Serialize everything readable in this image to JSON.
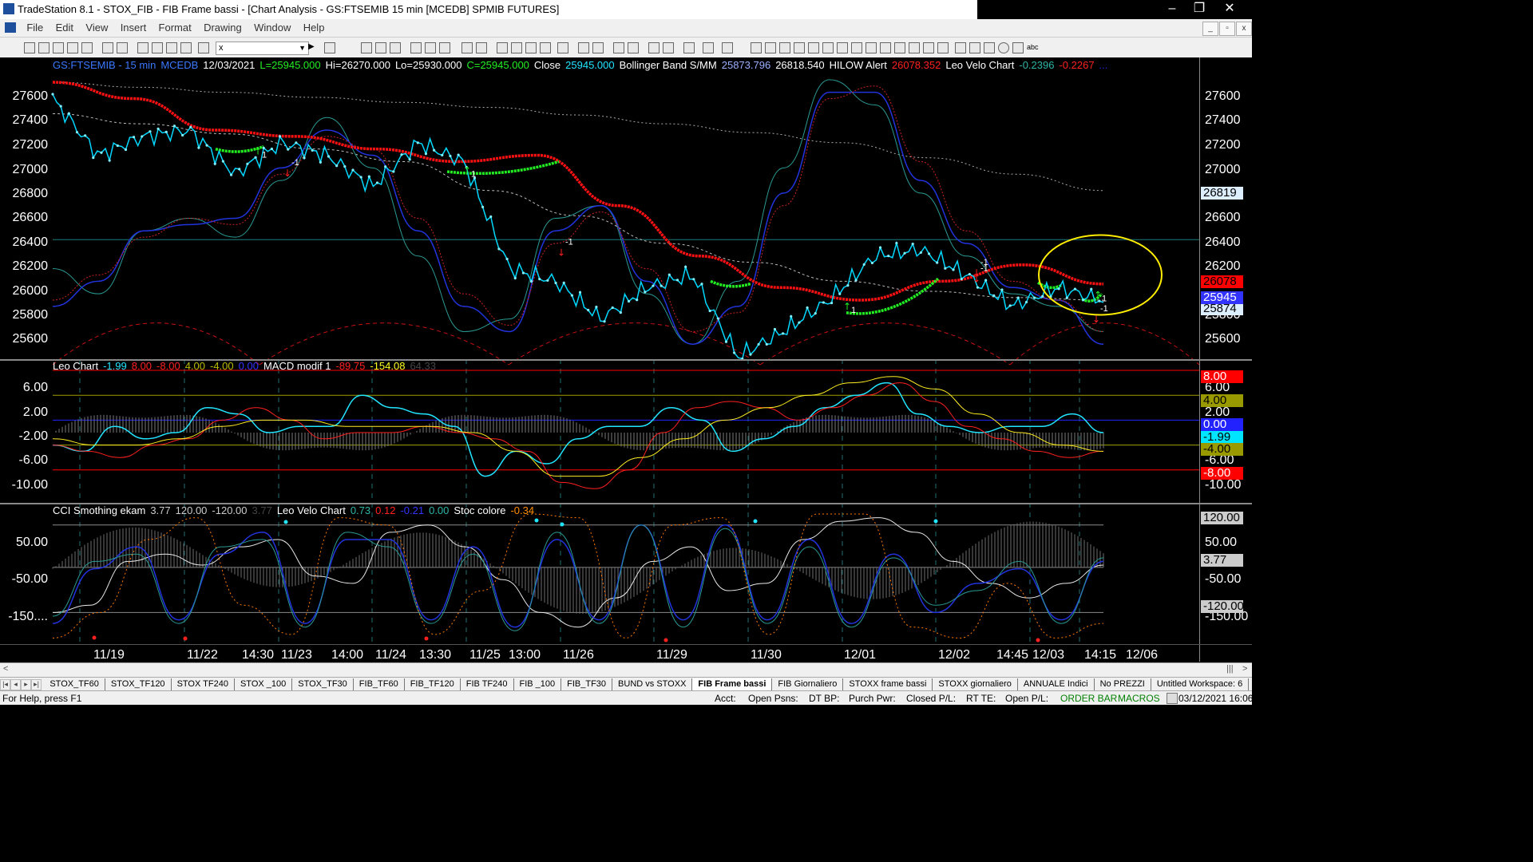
{
  "window": {
    "title": "TradeStation 8.1 - STOX_FIB - FIB Frame bassi - [Chart Analysis - GS:FTSEMIB  15 min  [MCEDB] SPMIB FUTURES]",
    "buttons": {
      "minimize": "–",
      "restore": "❐",
      "close": "✕"
    }
  },
  "menu": [
    "File",
    "Edit",
    "View",
    "Insert",
    "Format",
    "Drawing",
    "Window",
    "Help"
  ],
  "mdi_buttons": [
    "_",
    "▫",
    "x"
  ],
  "toolbar": {
    "symbol_value": "x",
    "dropdown": "▼"
  },
  "price_header": [
    {
      "text": "GS:FTSEMIB - 15 min",
      "color": "#3a78ff"
    },
    {
      "text": "MCEDB",
      "color": "#3a78ff"
    },
    {
      "text": "12/03/2021",
      "color": "#ffffff"
    },
    {
      "text": "L=25945.000",
      "color": "#22ee22"
    },
    {
      "text": "Hi=26270.000",
      "color": "#ffffff"
    },
    {
      "text": "Lo=25930.000",
      "color": "#ffffff"
    },
    {
      "text": "C=25945.000",
      "color": "#22ee22"
    },
    {
      "text": "Close",
      "color": "#ffffff"
    },
    {
      "text": "25945.000",
      "color": "#22e5ff"
    },
    {
      "text": "Bollinger Band S/MM",
      "color": "#ffffff"
    },
    {
      "text": "25873.796",
      "color": "#9ab0ff"
    },
    {
      "text": "26818.540",
      "color": "#ffffff"
    },
    {
      "text": "HILOW Alert",
      "color": "#ffffff"
    },
    {
      "text": "26078.352",
      "color": "#ff2020"
    },
    {
      "text": "Leo Velo Chart",
      "color": "#ffffff"
    },
    {
      "text": "-0.2396",
      "color": "#2fb5a8"
    },
    {
      "text": "-0.2267",
      "color": "#ff2020"
    },
    {
      "text": "...",
      "color": "#2222dd"
    }
  ],
  "price_axis_left": [
    "27600",
    "27400",
    "27200",
    "27000",
    "26800",
    "26600",
    "26400",
    "26200",
    "26000",
    "25800",
    "25600"
  ],
  "price_axis_right": [
    "27600",
    "27400",
    "27200",
    "27000",
    "26600",
    "26400",
    "26200",
    "25800",
    "25600"
  ],
  "price_tags": [
    {
      "text": "26819",
      "bg": "#ddeeff",
      "fg": "#000000"
    },
    {
      "text": "26078",
      "bg": "#ff0000",
      "fg": "#000000"
    },
    {
      "text": "25945",
      "bg": "#3333ff",
      "fg": "#ffffff"
    },
    {
      "text": "25874",
      "bg": "#ddeeff",
      "fg": "#000000"
    }
  ],
  "macd_header": [
    {
      "text": "Leo Chart",
      "color": "#ffffff"
    },
    {
      "text": "-1.99",
      "color": "#22e5ff"
    },
    {
      "text": "8.00",
      "color": "#ff2020"
    },
    {
      "text": "-8.00",
      "color": "#ff2020"
    },
    {
      "text": "4.00",
      "color": "#bbbb00"
    },
    {
      "text": "-4.00",
      "color": "#bbbb00"
    },
    {
      "text": "0.00",
      "color": "#3333ff"
    },
    {
      "text": "MACD modif 1",
      "color": "#ffffff"
    },
    {
      "text": "-89.75",
      "color": "#ff2020"
    },
    {
      "text": "-154.08",
      "color": "#ffff22"
    },
    {
      "text": "64.33",
      "color": "#444444"
    }
  ],
  "macd_axis_left": [
    "6.00",
    "2.00",
    "-2.00",
    "-6.00",
    "-10.00"
  ],
  "macd_axis_right": [
    "6.00",
    "2.00",
    "-6.00",
    "-10.00"
  ],
  "macd_tags": [
    {
      "text": "8.00",
      "bg": "#ff0000",
      "fg": "#ffffff"
    },
    {
      "text": "4.00",
      "bg": "#999900",
      "fg": "#000000"
    },
    {
      "text": "0.00",
      "bg": "#2222ff",
      "fg": "#ffffff"
    },
    {
      "text": "-1.99",
      "bg": "#00e5ff",
      "fg": "#000000"
    },
    {
      "text": "-4.00",
      "bg": "#999900",
      "fg": "#000000"
    },
    {
      "text": "-8.00",
      "bg": "#ff0000",
      "fg": "#ffffff"
    }
  ],
  "cci_header": [
    {
      "text": "CCI Smothing ekam",
      "color": "#ffffff"
    },
    {
      "text": "3.77",
      "color": "#cccccc"
    },
    {
      "text": "120.00",
      "color": "#cccccc"
    },
    {
      "text": "-120.00",
      "color": "#cccccc"
    },
    {
      "text": "3.77",
      "color": "#444444"
    },
    {
      "text": "Leo Velo Chart",
      "color": "#ffffff"
    },
    {
      "text": "0.73",
      "color": "#2fb5a8"
    },
    {
      "text": "0.12",
      "color": "#ff2020"
    },
    {
      "text": "-0.21",
      "color": "#3333ff"
    },
    {
      "text": "0.00",
      "color": "#2fb5a8"
    },
    {
      "text": "Stoc colore",
      "color": "#ffffff"
    },
    {
      "text": "-0.34",
      "color": "#ff8c00"
    }
  ],
  "cci_axis_left": [
    "50.00",
    "-50.00",
    "-150...."
  ],
  "cci_axis_right": [
    "50.00",
    "-50.00",
    "-150.00"
  ],
  "cci_tags": [
    {
      "text": "120.00",
      "bg": "#cccccc",
      "fg": "#000000"
    },
    {
      "text": "3.77",
      "bg": "#cccccc",
      "fg": "#000000"
    },
    {
      "text": "-120.00",
      "bg": "#cccccc",
      "fg": "#000000"
    }
  ],
  "x_axis": [
    "11/19",
    "11/22",
    "14:30",
    "11/23",
    "14:00",
    "11/24",
    "13:30",
    "11/25",
    "13:00",
    "11/26",
    "11/29",
    "11/30",
    "12/01",
    "12/02",
    "14:45",
    "12/03",
    "14:15",
    "12/06"
  ],
  "signal_labels": [
    "1",
    "-1",
    "1",
    "-1",
    "-1",
    "1",
    "-1",
    "1",
    "-1"
  ],
  "tabs": [
    "STOX_TF60",
    "STOX_TF120",
    "STOX TF240",
    "STOX _100",
    "STOX_TF30",
    "FIB_TF60",
    "FIB_TF120",
    "FIB TF240",
    "FIB _100",
    "FIB_TF30",
    "BUND vs STOXX",
    "FIB Frame bassi",
    "FIB Giornaliero",
    "STOXX frame bassi",
    "STOXX giornaliero",
    "ANNUALE Indici",
    "No PREZZI",
    "Untitled Workspace: 6"
  ],
  "active_tab": "FIB Frame bassi",
  "status": {
    "help": "For Help, press F1",
    "acct": "Acct:",
    "open_psns": "Open Psns:",
    "dt_bp": "DT BP:",
    "purch_pwr": "Purch Pwr:",
    "closed_pl": "Closed P/L:",
    "rt_te": "RT TE:",
    "open_pl": "Open P/L:",
    "order_bar": "ORDER BAR",
    "macros": "MACROS",
    "datetime": "03/12/2021 16:06"
  },
  "chart_data": {
    "type": "line",
    "title": "GS:FTSEMIB - 15 min",
    "x_categories": [
      "11/19",
      "11/22",
      "11/23",
      "11/24",
      "11/25",
      "11/26",
      "11/29",
      "11/30",
      "12/01",
      "12/02",
      "12/03",
      "12/06"
    ],
    "series": [
      {
        "name": "Close",
        "color": "#22e5ff",
        "values": [
          27550,
          27100,
          27250,
          27300,
          26950,
          27200,
          27100,
          26850,
          27200,
          27050,
          26200,
          26100,
          25800,
          26050,
          26150,
          25500,
          25700,
          25950,
          26300,
          26350,
          26150,
          25900,
          26050,
          25945
        ]
      },
      {
        "name": "HILOW Alert",
        "color": "#ff2020",
        "values": [
          27680,
          27550,
          27300,
          27250,
          27150,
          27050,
          27100,
          26700,
          26300,
          26050,
          25950,
          26100,
          26230,
          26078
        ]
      }
    ],
    "ylim": [
      25500,
      27750
    ],
    "macd": {
      "levels": [
        8.0,
        4.0,
        0.0,
        -4.0,
        -8.0
      ],
      "ylim": [
        -12,
        8
      ]
    },
    "cci": {
      "levels": [
        120.0,
        3.77,
        -120.0
      ],
      "ylim": [
        -200,
        150
      ]
    }
  }
}
